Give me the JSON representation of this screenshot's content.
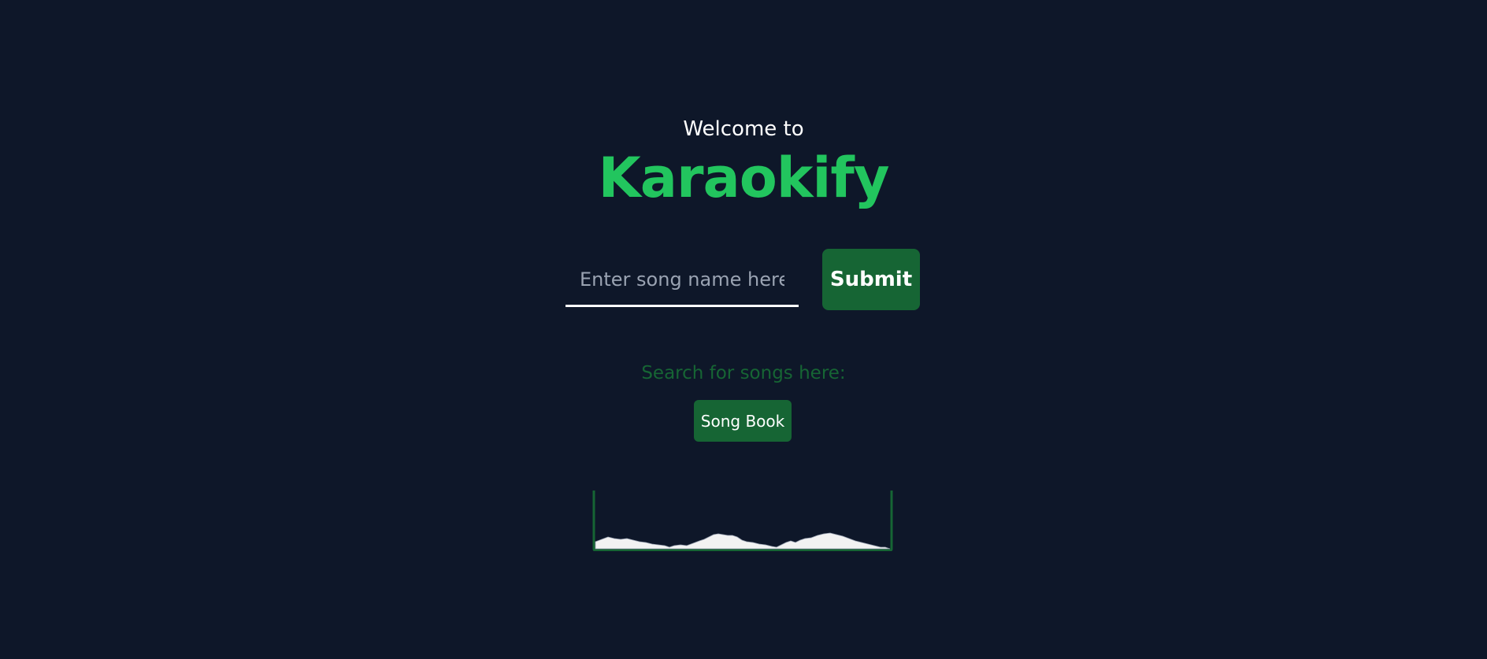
{
  "header": {
    "welcome": "Welcome to",
    "brand": "Karaokify"
  },
  "search": {
    "placeholder": "Enter song name here...",
    "submit_label": "Submit"
  },
  "songbook": {
    "prompt": "Search for songs here:",
    "button_label": "Song Book"
  },
  "colors": {
    "background": "#0e1729",
    "accent": "#22c55e",
    "button": "#166534",
    "text": "#ffffff"
  }
}
